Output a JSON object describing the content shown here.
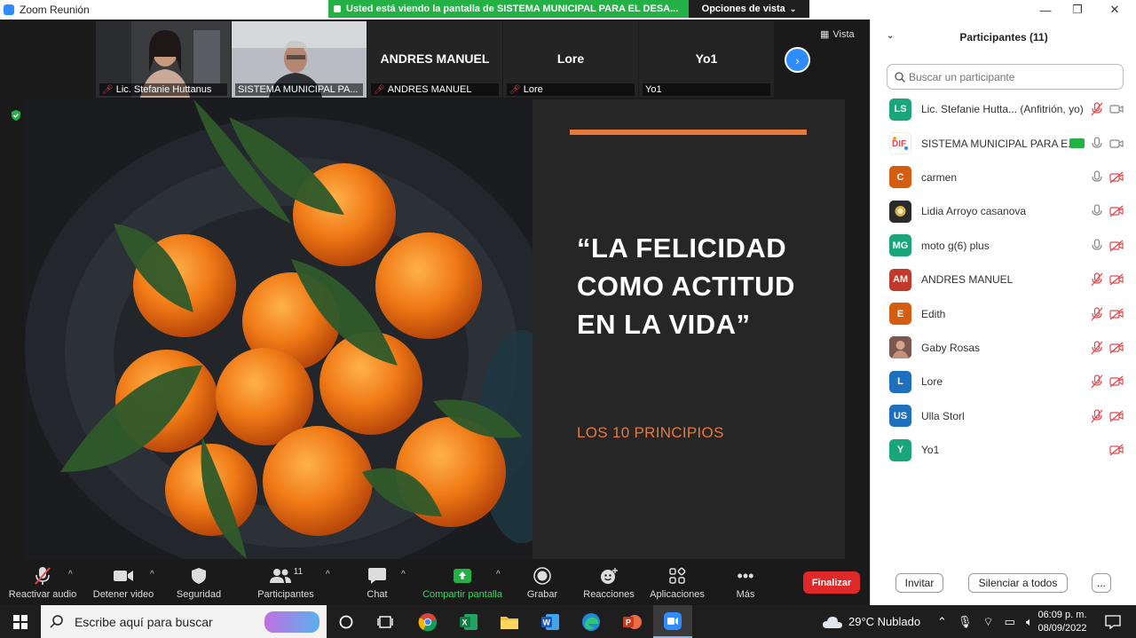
{
  "window": {
    "title": "Zoom Reunión",
    "share_banner": "Usted está viendo la pantalla de SISTEMA MUNICIPAL PARA EL DESA...",
    "view_options": "Opciones de vista",
    "view_options_icon": "chevron-down-icon"
  },
  "gallery": {
    "vista_label": "Vista",
    "tiles": [
      {
        "label": "Lic. Stefanie Huttanus",
        "muted": true,
        "video": true
      },
      {
        "label": "SISTEMA MUNICIPAL PA...",
        "muted": false,
        "video": true
      },
      {
        "label": "ANDRES MANUEL",
        "big_name": "ANDRES MANUEL",
        "muted": true,
        "video": false
      },
      {
        "label": "Lore",
        "big_name": "Lore",
        "muted": true,
        "video": false
      },
      {
        "label": "Yo1",
        "big_name": "Yo1",
        "muted": false,
        "video": false
      }
    ]
  },
  "slide": {
    "headline": "“LA FELICIDAD COMO ACTITUD EN LA VIDA”",
    "subtitle": "LOS 10 PRINCIPIOS",
    "accent_color": "#e8793b"
  },
  "toolbar": {
    "audio": "Reactivar audio",
    "video": "Detener video",
    "security": "Seguridad",
    "participants": "Participantes",
    "participants_count": "11",
    "chat": "Chat",
    "share": "Compartir pantalla",
    "record": "Grabar",
    "reactions": "Reacciones",
    "apps": "Aplicaciones",
    "more": "Más",
    "end": "Finalizar"
  },
  "panel": {
    "title": "Participantes (11)",
    "search_placeholder": "Buscar un participante",
    "participants": [
      {
        "initials": "LS",
        "name": "Lic. Stefanie Hutta...",
        "role": "(Anfitrión, yo)",
        "color": "#1aa67a",
        "mic": "muted",
        "video": "on"
      },
      {
        "initials": "",
        "name": "SISTEMA MUNICIPAL PARA E...",
        "role": "",
        "color": "#ffffff",
        "mic": "on",
        "video": "on",
        "sharing": true
      },
      {
        "initials": "C",
        "name": "carmen",
        "role": "",
        "color": "#d45d12",
        "mic": "on",
        "video": "off"
      },
      {
        "initials": "",
        "name": "Lidia Arroyo casanova",
        "role": "",
        "color": "#2a2a2a",
        "mic": "on",
        "video": "off"
      },
      {
        "initials": "MG",
        "name": "moto g(6) plus",
        "role": "",
        "color": "#1aa67a",
        "mic": "on",
        "video": "off"
      },
      {
        "initials": "AM",
        "name": "ANDRES MANUEL",
        "role": "",
        "color": "#c0392b",
        "mic": "muted",
        "video": "off"
      },
      {
        "initials": "E",
        "name": "Edith",
        "role": "",
        "color": "#d45d12",
        "mic": "muted",
        "video": "off"
      },
      {
        "initials": "",
        "name": "Gaby Rosas",
        "role": "",
        "color": "#9b6a55",
        "mic": "muted",
        "video": "off"
      },
      {
        "initials": "L",
        "name": "Lore",
        "role": "",
        "color": "#1f6fbf",
        "mic": "muted",
        "video": "off"
      },
      {
        "initials": "US",
        "name": "Ulla Storl",
        "role": "",
        "color": "#1f6fbf",
        "mic": "muted",
        "video": "off"
      },
      {
        "initials": "Y",
        "name": "Yo1",
        "role": "",
        "color": "#1aa67a",
        "mic": "none",
        "video": "off"
      }
    ],
    "invite": "Invitar",
    "mute_all": "Silenciar a todos",
    "more": "..."
  },
  "taskbar": {
    "search_placeholder": "Escribe aquí para buscar",
    "weather": "29°C  Nublado",
    "time": "06:09 p. m.",
    "date": "08/09/2022"
  }
}
